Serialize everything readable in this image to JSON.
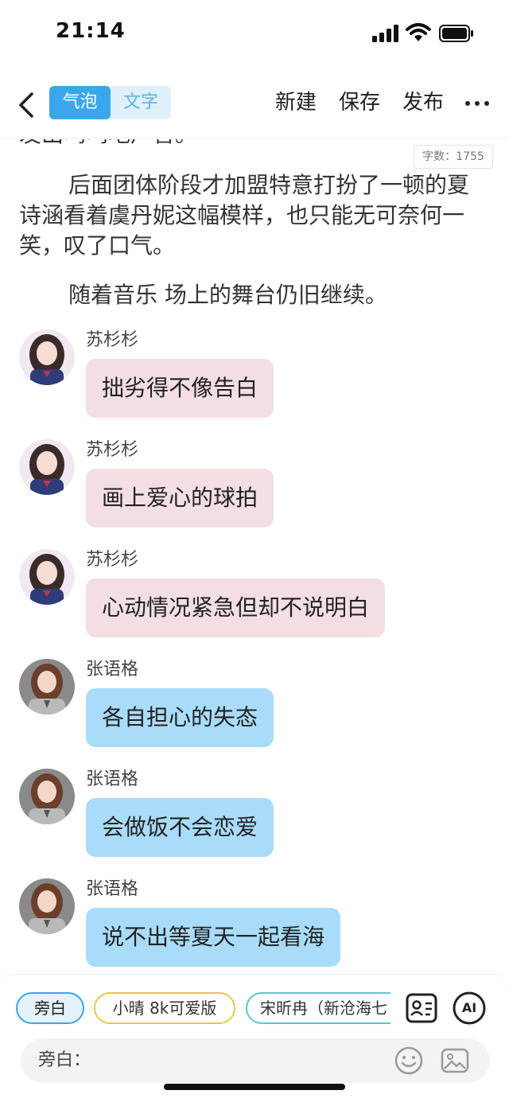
{
  "status": {
    "time": "21:14"
  },
  "header": {
    "mode_tabs": [
      "气泡",
      "文字"
    ],
    "new_label": "新建",
    "save_label": "保存",
    "publish_label": "发布"
  },
  "story": {
    "cut_line": "发出呜呜地声音。",
    "word_count": "字数：1755",
    "paragraphs": [
      "后面团体阶段才加盟特意打扮了一顿的夏诗涵看着虞丹妮这幅模样，也只能无可奈何一笑，叹了口气。",
      "随着音乐 场上的舞台仍旧继续。"
    ]
  },
  "messages": [
    {
      "sender": "苏杉杉",
      "text": "拙劣得不像告白",
      "color": "pink"
    },
    {
      "sender": "苏杉杉",
      "text": "画上爱心的球拍",
      "color": "pink"
    },
    {
      "sender": "苏杉杉",
      "text": "心动情况紧急但却不说明白",
      "color": "pink"
    },
    {
      "sender": "张语格",
      "text": "各自担心的失态",
      "color": "blue"
    },
    {
      "sender": "张语格",
      "text": "会做饭不会恋爱",
      "color": "blue"
    },
    {
      "sender": "张语格",
      "text": "说不出等夏天一起看海",
      "color": "blue"
    }
  ],
  "bottom": {
    "chips": [
      "旁白",
      "小晴 8k可爱版",
      "宋昕冉（新沧海七"
    ],
    "ai_label": "AI",
    "input_label": "旁白：",
    "input_placeholder": ""
  },
  "colors": {
    "accent": "#3aa6ec",
    "pink_bubble": "#f3dfe1",
    "blue_bubble": "#a9dcfa",
    "chip_yellow": "#e6c94a",
    "chip_teal": "#58c7cf"
  },
  "icons": [
    "back-icon",
    "more-icon",
    "character-card-icon",
    "ai-icon",
    "emoji-icon",
    "image-icon"
  ]
}
